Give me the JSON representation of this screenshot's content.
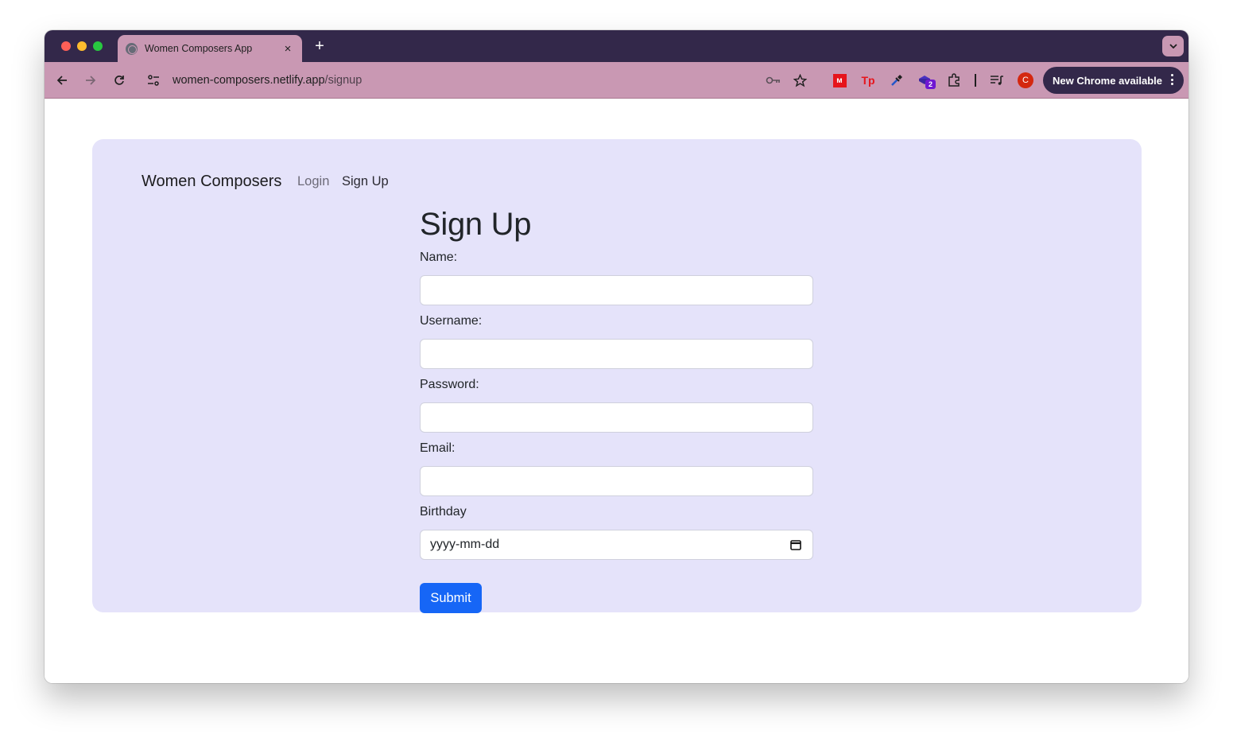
{
  "browser": {
    "tab": {
      "title": "Women Composers App",
      "favicon": "globe-icon",
      "close": "×"
    },
    "new_tab": "+",
    "url": {
      "host": "women-composers.netlify.app",
      "path": "/signup"
    },
    "toolbar_icons": [
      "key-icon",
      "star-icon",
      "mendeley-icon",
      "tp-icon",
      "eyedropper-icon",
      "extension-badge-icon",
      "puzzle-icon",
      "reading-list-icon",
      "profile-avatar"
    ],
    "extension_badge_count": "2",
    "profile_initial": "C",
    "update_button": "New Chrome available",
    "colors": {
      "frame": "#33284a",
      "toolbar": "#c998b3",
      "profile": "#d4270f",
      "badge": "#6f17d2"
    }
  },
  "navbar": {
    "brand": "Women Composers",
    "links": [
      {
        "label": "Login"
      },
      {
        "label": "Sign Up"
      }
    ]
  },
  "form": {
    "title": "Sign Up",
    "fields": [
      {
        "label": "Name:",
        "value": "",
        "type": "text"
      },
      {
        "label": "Username:",
        "value": "",
        "type": "text"
      },
      {
        "label": "Password:",
        "value": "",
        "type": "password"
      },
      {
        "label": "Email:",
        "value": "",
        "type": "email"
      },
      {
        "label": "Birthday",
        "value": "yyyy-mm-dd",
        "type": "date"
      }
    ],
    "submit_label": "Submit"
  },
  "colors": {
    "card_bg": "#e5e3fa",
    "primary": "#1666f6"
  }
}
